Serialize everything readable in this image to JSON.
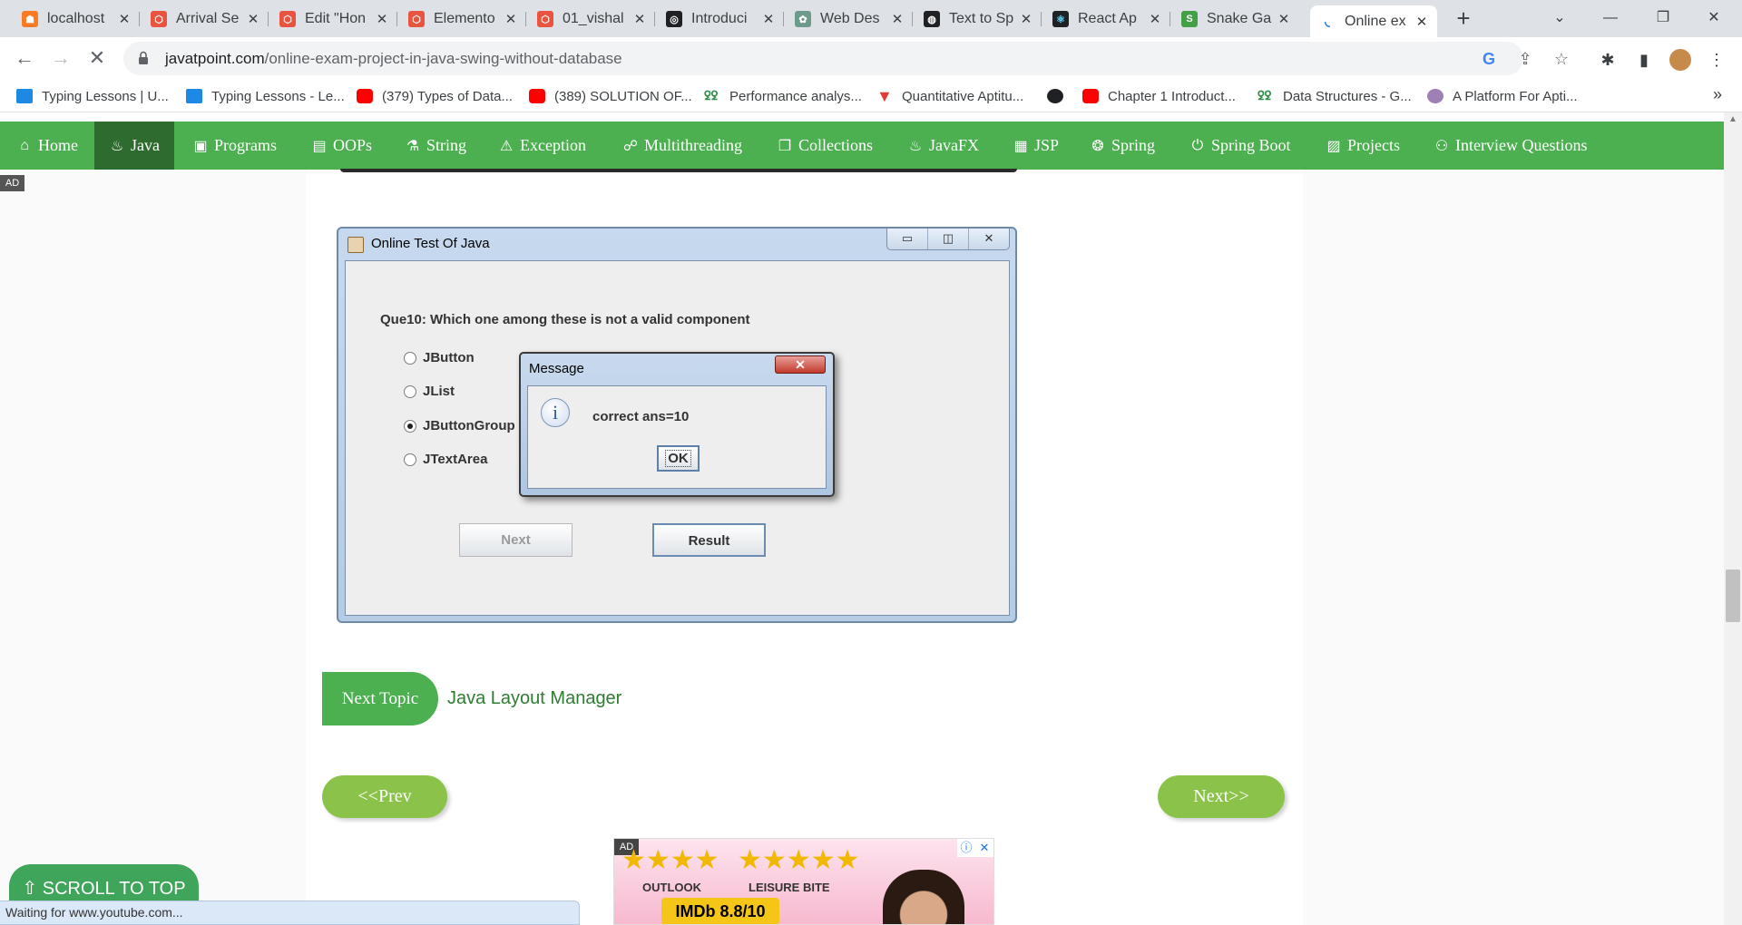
{
  "browser": {
    "tabs": [
      {
        "title": "localhost",
        "icon": "xampp-icon",
        "color": "#fb7a24"
      },
      {
        "title": "Arrival Se",
        "icon": "codepen-icon",
        "color": "#e8543f"
      },
      {
        "title": "Edit \"Hon",
        "icon": "codepen-icon",
        "color": "#e8543f"
      },
      {
        "title": "Elemento",
        "icon": "codepen-icon",
        "color": "#e8543f"
      },
      {
        "title": "01_vishal",
        "icon": "codepen-icon",
        "color": "#e8543f"
      },
      {
        "title": "Introduci",
        "icon": "gpt-icon",
        "color": "#202124"
      },
      {
        "title": "Web Des",
        "icon": "openai-icon",
        "color": "#6c9a8b"
      },
      {
        "title": "Text to Sp",
        "icon": "globe-icon",
        "color": "#202124"
      },
      {
        "title": "React Ap",
        "icon": "react-icon",
        "color": "#202124"
      },
      {
        "title": "Snake Ga",
        "icon": "snake-icon",
        "color": "#43a047"
      },
      {
        "title": "Online ex",
        "icon": "javatpoint-icon",
        "color": "#1a73e8"
      }
    ],
    "new_tab": "+",
    "url_host": "javatpoint.com",
    "url_path": "/online-exam-project-in-java-swing-without-database",
    "bookmarks": [
      {
        "label": "Typing Lessons | U...",
        "icon": "typing-icon"
      },
      {
        "label": "Typing Lessons - Le...",
        "icon": "typing-icon"
      },
      {
        "label": "(379) Types of Data...",
        "icon": "youtube-icon"
      },
      {
        "label": "(389) SOLUTION OF...",
        "icon": "youtube-icon"
      },
      {
        "label": "Performance analys...",
        "icon": "gfg-icon"
      },
      {
        "label": "Quantitative Aptitu...",
        "icon": "indiabix-icon"
      },
      {
        "label": "",
        "icon": "globe-icon"
      },
      {
        "label": "Chapter 1 Introduct...",
        "icon": "youtube-icon"
      },
      {
        "label": "Data Structures - G...",
        "icon": "gfg-icon"
      },
      {
        "label": "A Platform For Apti...",
        "icon": "aptitude-icon"
      }
    ],
    "bookmarks_more": "»",
    "status": "Waiting for www.youtube.com..."
  },
  "sitenav": {
    "items": [
      {
        "label": "Home",
        "icon": "home-icon"
      },
      {
        "label": "Java",
        "icon": "java-icon"
      },
      {
        "label": "Programs",
        "icon": "monitor-icon"
      },
      {
        "label": "OOPs",
        "icon": "window-icon"
      },
      {
        "label": "String",
        "icon": "flask-icon"
      },
      {
        "label": "Exception",
        "icon": "warning-icon"
      },
      {
        "label": "Multithreading",
        "icon": "network-icon"
      },
      {
        "label": "Collections",
        "icon": "copy-icon"
      },
      {
        "label": "JavaFX",
        "icon": "javafx-icon"
      },
      {
        "label": "JSP",
        "icon": "jsp-icon"
      },
      {
        "label": "Spring",
        "icon": "spring-icon"
      },
      {
        "label": "Spring Boot",
        "icon": "power-icon"
      },
      {
        "label": "Projects",
        "icon": "projects-icon"
      },
      {
        "label": "Interview Questions",
        "icon": "people-icon"
      }
    ],
    "active": "Java"
  },
  "ad_label": "AD",
  "swing_window": {
    "title": "Online Test Of Java",
    "question": "Que10: Which one among these is not a valid component",
    "options": [
      "JButton",
      "JList",
      "JButtonGroup",
      "JTextArea"
    ],
    "selected": "JButtonGroup",
    "next_button": "Next",
    "result_button": "Result"
  },
  "message_dialog": {
    "title": "Message",
    "text": "correct ans=10",
    "ok": "OK"
  },
  "next_topic": {
    "label": "Next Topic",
    "link": "Java Layout Manager"
  },
  "pager": {
    "prev": "<<Prev",
    "next": "Next>>"
  },
  "ad": {
    "tag": "AD",
    "source1": "OUTLOOK",
    "source2": "LEISURE BITE",
    "rating": "IMDb 8.8/10"
  },
  "scroll_to_top": "⇧ SCROLL TO TOP"
}
